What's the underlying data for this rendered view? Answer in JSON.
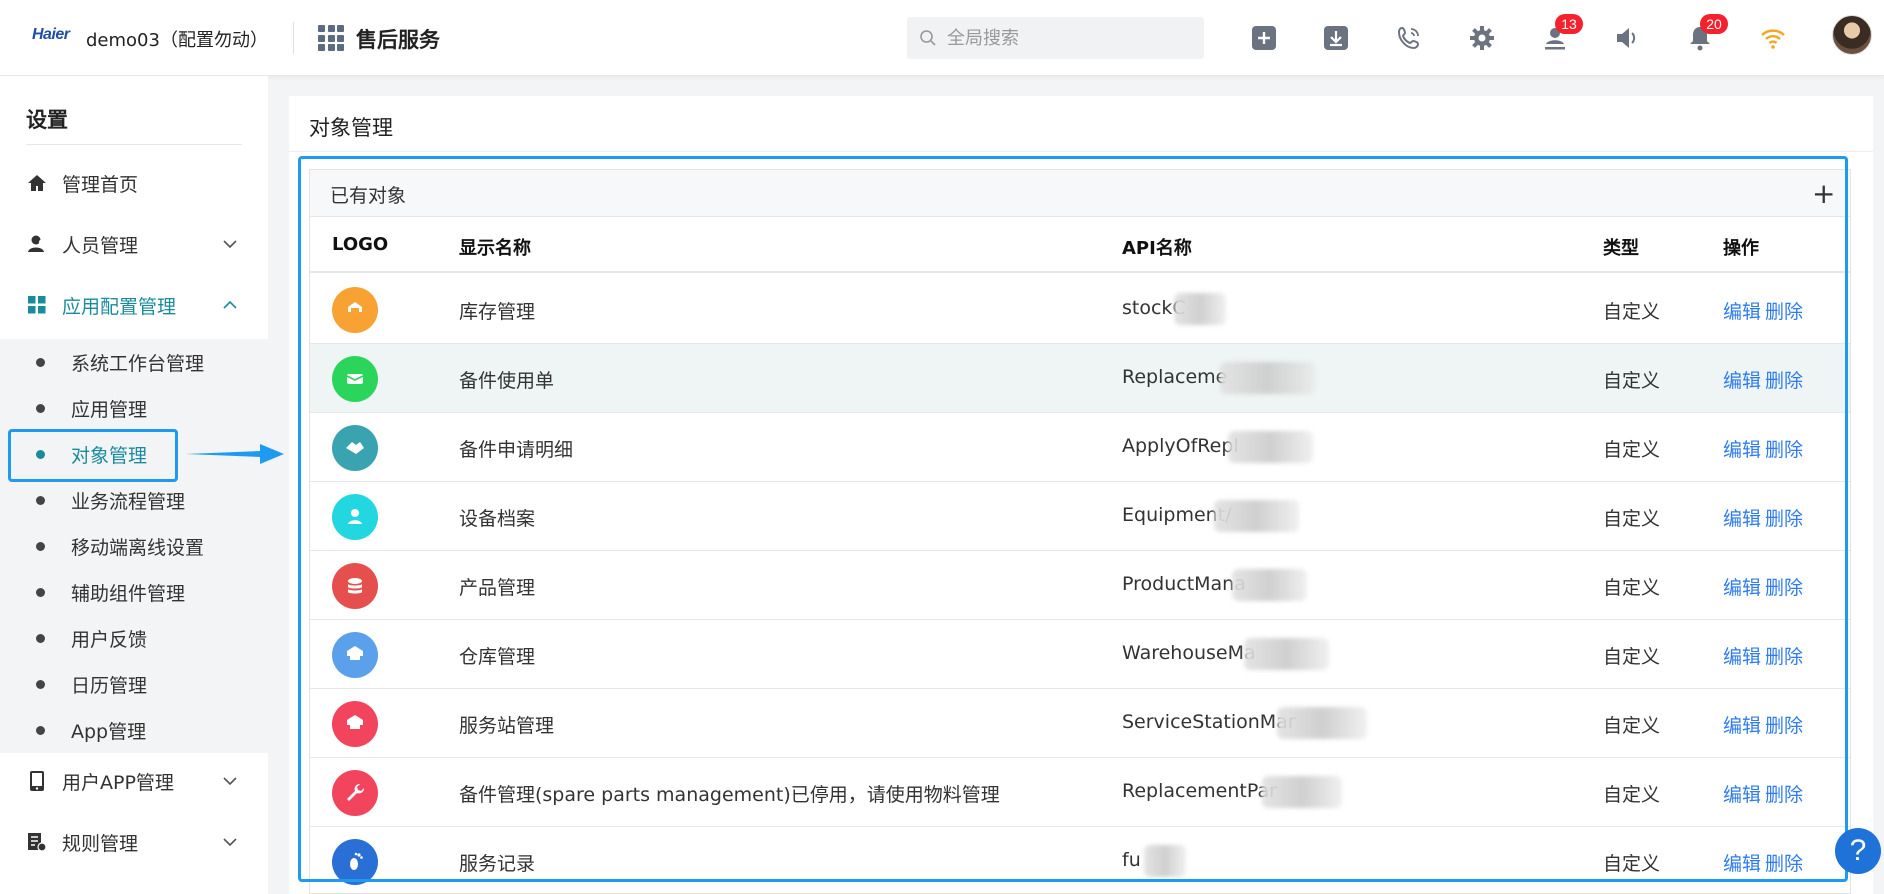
{
  "header": {
    "logo_text": "Haier",
    "tenant": "demo03（配置勿动）",
    "app_name": "售后服务",
    "search_placeholder": "全局搜索",
    "notification_badge_1": "13",
    "notification_badge_2": "20"
  },
  "sidebar": {
    "title": "设置",
    "items": [
      {
        "label": "管理首页",
        "icon": "home-icon"
      },
      {
        "label": "人员管理",
        "icon": "user-icon"
      },
      {
        "label": "应用配置管理",
        "icon": "grid-icon"
      },
      {
        "label": "用户APP管理",
        "icon": "phone-icon"
      },
      {
        "label": "规则管理",
        "icon": "rules-icon"
      }
    ],
    "sub_items": [
      "系统工作台管理",
      "应用管理",
      "对象管理",
      "业务流程管理",
      "移动端离线设置",
      "辅助组件管理",
      "用户反馈",
      "日历管理",
      "App管理"
    ]
  },
  "main": {
    "title": "对象管理",
    "panel_title": "已有对象",
    "columns": {
      "logo": "LOGO",
      "display": "显示名称",
      "api": "API名称",
      "type": "类型",
      "action": "操作"
    },
    "action_edit": "编辑",
    "action_delete": "删除",
    "rows": [
      {
        "name": "库存管理",
        "api": "stockC",
        "type": "自定义",
        "color": "#f7a233"
      },
      {
        "name": "备件使用单",
        "api": "Replaceme",
        "type": "自定义",
        "color": "#2bd45a"
      },
      {
        "name": "备件申请明细",
        "api": "ApplyOfRepl",
        "type": "自定义",
        "color": "#3aa3b0"
      },
      {
        "name": "设备档案",
        "api": "Equipment/",
        "type": "自定义",
        "color": "#23d7e0"
      },
      {
        "name": "产品管理",
        "api": "ProductMana",
        "type": "自定义",
        "color": "#e5504e"
      },
      {
        "name": "仓库管理",
        "api": "WarehouseMa",
        "type": "自定义",
        "color": "#5aa0ea"
      },
      {
        "name": "服务站管理",
        "api": "ServiceStationMar",
        "type": "自定义",
        "color": "#f2455d"
      },
      {
        "name": "备件管理(spare parts management)已停用，请使用物料管理",
        "api": "ReplacementPar",
        "type": "自定义",
        "color": "#f2455d"
      },
      {
        "name": "服务记录",
        "api": "fu",
        "type": "自定义",
        "color": "#2a6fd6"
      }
    ]
  },
  "help_label": "?"
}
